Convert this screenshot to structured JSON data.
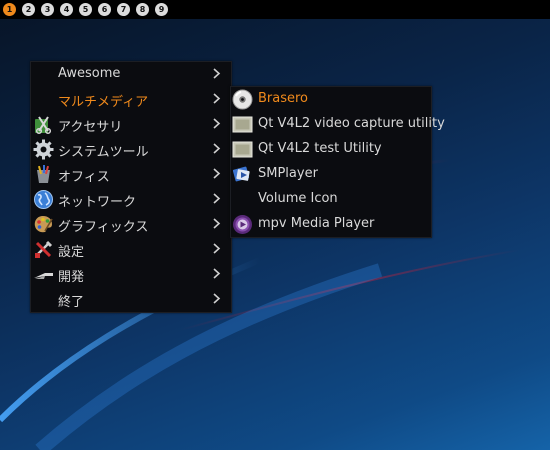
{
  "taglist": {
    "tags": [
      "1",
      "2",
      "3",
      "4",
      "5",
      "6",
      "7",
      "8",
      "9"
    ],
    "active_index": 0,
    "active_color": "#f08a1c"
  },
  "main_menu": {
    "items": [
      {
        "label": "Awesome",
        "icon": "none",
        "has_submenu": true
      },
      {
        "label": "マルチメディア",
        "icon": "none",
        "has_submenu": true,
        "highlighted": true
      },
      {
        "label": "アクセサリ",
        "icon": "accessories-icon",
        "has_submenu": true
      },
      {
        "label": "システムツール",
        "icon": "gear-icon",
        "has_submenu": true
      },
      {
        "label": "オフィス",
        "icon": "office-icon",
        "has_submenu": true
      },
      {
        "label": "ネットワーク",
        "icon": "globe-icon",
        "has_submenu": true
      },
      {
        "label": "グラフィックス",
        "icon": "palette-icon",
        "has_submenu": true
      },
      {
        "label": "設定",
        "icon": "settings-tools-icon",
        "has_submenu": true
      },
      {
        "label": "開発",
        "icon": "trowel-icon",
        "has_submenu": true
      },
      {
        "label": "終了",
        "icon": "none",
        "has_submenu": true
      }
    ]
  },
  "submenu": {
    "items": [
      {
        "label": "Brasero",
        "icon": "disc-icon",
        "highlighted": true
      },
      {
        "label": "Qt V4L2 video capture utility",
        "icon": "video-frame-icon"
      },
      {
        "label": "Qt V4L2 test Utility",
        "icon": "video-frame-icon"
      },
      {
        "label": "SMPlayer",
        "icon": "smplayer-icon"
      },
      {
        "label": "Volume Icon",
        "icon": "none"
      },
      {
        "label": "mpv Media Player",
        "icon": "mpv-icon"
      }
    ]
  },
  "colors": {
    "highlight": "#f08a1c",
    "menu_bg": "#0b0c10",
    "menu_text": "#d9d9d9"
  }
}
